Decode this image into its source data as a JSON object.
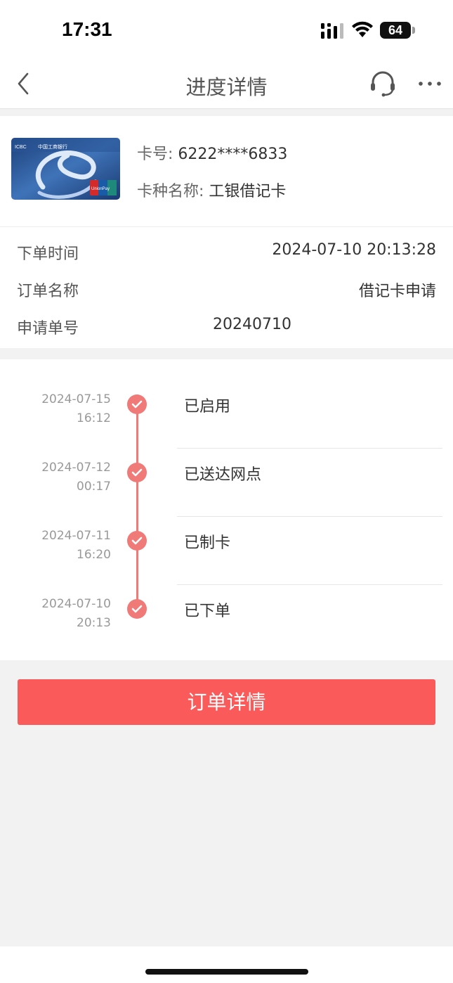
{
  "status_bar": {
    "time": "17:31",
    "battery": "64"
  },
  "nav": {
    "title": "进度详情",
    "back_icon": "chevron-left-icon",
    "service_icon": "headset-icon",
    "more_icon": "more-dots-icon"
  },
  "card": {
    "number_label": "卡号:",
    "number_value": "6222****6833",
    "type_label": "卡种名称:",
    "type_value": "工银借记卡",
    "image_texts": {
      "bank_abbr": "ICBC",
      "bank_name": "中国工商银行",
      "network": "UnionPay"
    }
  },
  "info": [
    {
      "label": "下单时间",
      "value": "2024-07-10 20:13:28"
    },
    {
      "label": "订单名称",
      "value": "借记卡申请"
    },
    {
      "label": "申请单号",
      "value": "20240710"
    }
  ],
  "timeline": [
    {
      "date": "2024-07-15",
      "time": "16:12",
      "status": "已启用"
    },
    {
      "date": "2024-07-12",
      "time": "00:17",
      "status": "已送达网点"
    },
    {
      "date": "2024-07-11",
      "time": "16:20",
      "status": "已制卡"
    },
    {
      "date": "2024-07-10",
      "time": "20:13",
      "status": "已下单"
    }
  ],
  "actions": {
    "order_detail_label": "订单详情"
  },
  "colors": {
    "accent": "#fb5a5a",
    "timeline": "#f07a78"
  }
}
